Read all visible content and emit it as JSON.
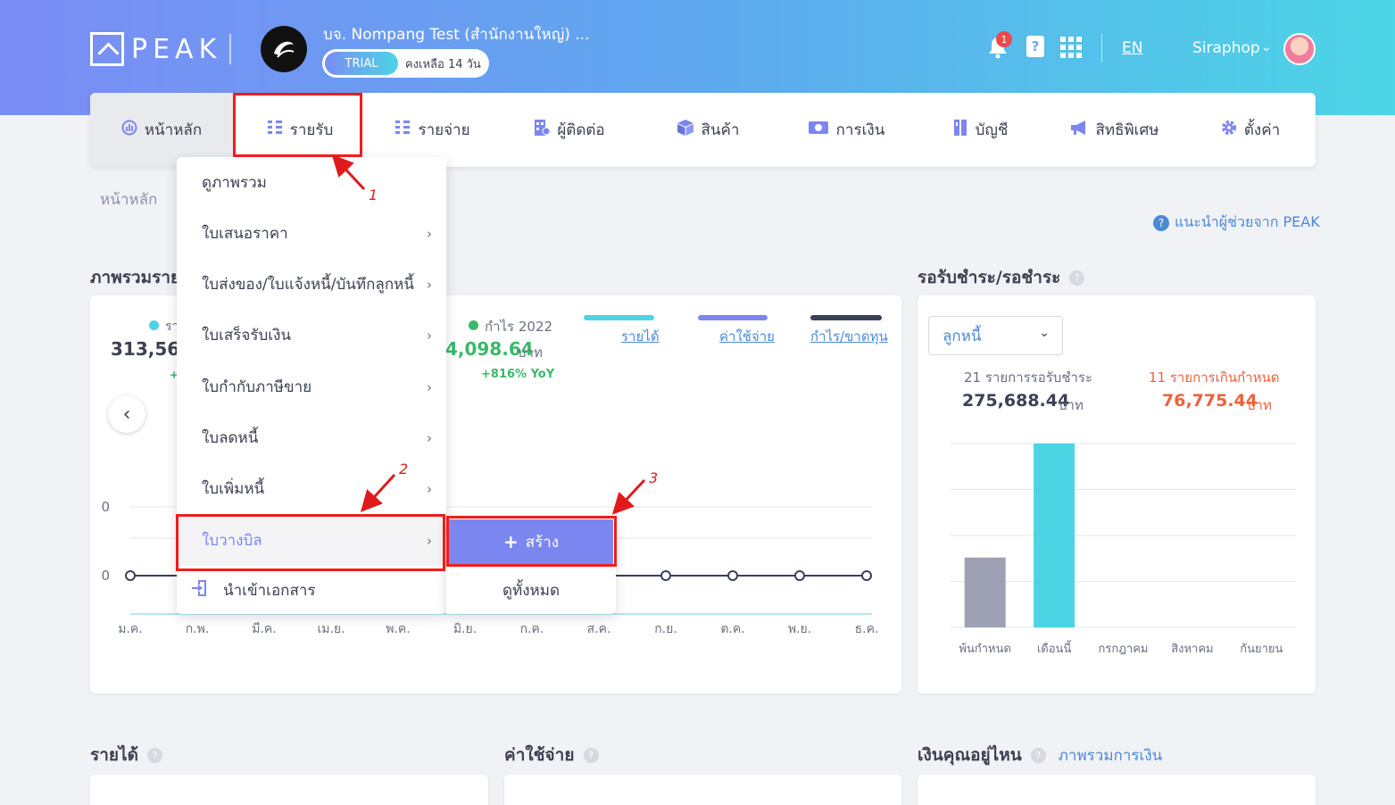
{
  "header": {
    "logo_text": "PEAK",
    "company_name": "บจ. Nompang Test (สำนักงานใหญ่) ...",
    "trial_badge": "TRIAL",
    "trial_remaining": "คงเหลือ 14 วัน",
    "notification_count": "1",
    "language": "EN",
    "username": "Siraphop",
    "book_icon_glyph": "?"
  },
  "nav": {
    "items": [
      {
        "label": "หน้าหลัก",
        "icon": "dashboard-icon"
      },
      {
        "label": "รายรับ",
        "icon": "income-icon"
      },
      {
        "label": "รายจ่าย",
        "icon": "expense-icon"
      },
      {
        "label": "ผู้ติดต่อ",
        "icon": "contacts-icon"
      },
      {
        "label": "สินค้า",
        "icon": "product-box-icon"
      },
      {
        "label": "การเงิน",
        "icon": "money-icon"
      },
      {
        "label": "บัญชี",
        "icon": "ledger-icon"
      },
      {
        "label": "สิทธิพิเศษ",
        "icon": "megaphone-icon"
      },
      {
        "label": "ตั้งค่า",
        "icon": "gear-icon"
      }
    ]
  },
  "breadcrumb": "หน้าหลัก",
  "help_link": "แนะนำผู้ช่วยจาก PEAK",
  "overview": {
    "title": "ภาพรวมราย",
    "legend_left_prefix": "รา",
    "value_left": "313,565",
    "yoy_left_prefix": "+",
    "profit_label": "กำไร 2022",
    "profit_value": "4,098.64",
    "profit_unit": "บาท",
    "profit_yoy": "+816% YoY",
    "series_labels": [
      "รายได้",
      "ค่าใช้จ่าย",
      "กำไร/ขาดทุน"
    ],
    "series_colors": [
      "#4dd4e4",
      "#7c86f0",
      "#3a3f5c"
    ]
  },
  "chart_data": {
    "type": "line",
    "categories": [
      "ม.ค.",
      "ก.พ.",
      "มี.ค.",
      "เม.ย.",
      "พ.ค.",
      "มิ.ย.",
      "ก.ค.",
      "ส.ค.",
      "ก.ย.",
      "ต.ค.",
      "พ.ย.",
      "ธ.ค."
    ],
    "y_tick_labels": [
      "0",
      "0"
    ],
    "visible_points": [
      {
        "month": "ม.ค.",
        "value": 0
      },
      {
        "month": "ก.ย.",
        "value": 0
      },
      {
        "month": "ต.ค.",
        "value": 0
      },
      {
        "month": "พ.ย.",
        "value": 0
      },
      {
        "month": "ธ.ค.",
        "value": 0
      }
    ]
  },
  "receivables": {
    "title": "รอรับชำระ/รอชำระ",
    "select_value": "ลูกหนี้",
    "pending_label": "21 รายการรอรับชำระ",
    "pending_value": "275,688.44",
    "overdue_label": "11 รายการเกินกำหนด",
    "overdue_value": "76,775.44",
    "unit": "บาท",
    "bar_categories": [
      "พ้นกำหนด",
      "เดือนนี้",
      "กรกฎาคม",
      "สิงหาคม",
      "กันยายน"
    ],
    "bar_values_fraction": [
      0.38,
      1.0,
      0,
      0,
      0
    ],
    "bar_colors": [
      "#9ea1b4",
      "#4dd4e4"
    ]
  },
  "bottom": {
    "income_title": "รายได้",
    "expense_title": "ค่าใช้จ่าย",
    "money_title": "เงินคุณอยู่ไหน",
    "money_link": "ภาพรวมการเงิน"
  },
  "dropdown": {
    "items": [
      {
        "label": "ดูภาพรวม",
        "has_submenu": false
      },
      {
        "label": "ใบเสนอราคา",
        "has_submenu": true
      },
      {
        "label": "ใบส่งของ/ใบแจ้งหนี้/บันทึกลูกหนี้",
        "has_submenu": true
      },
      {
        "label": "ใบเสร็จรับเงิน",
        "has_submenu": true
      },
      {
        "label": "ใบกำกับภาษีขาย",
        "has_submenu": true
      },
      {
        "label": "ใบลดหนี้",
        "has_submenu": true
      },
      {
        "label": "ใบเพิ่มหนี้",
        "has_submenu": true
      },
      {
        "label": "ใบวางบิล",
        "has_submenu": true
      }
    ],
    "import_label": "นำเข้าเอกสาร",
    "submenu_create": "สร้าง",
    "submenu_view_all": "ดูทั้งหมด"
  },
  "annotations": [
    "1",
    "2",
    "3"
  ]
}
